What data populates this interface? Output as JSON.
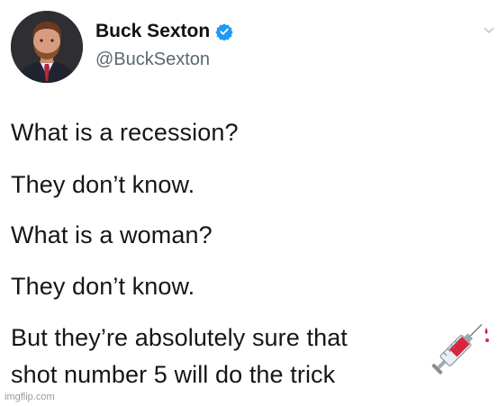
{
  "tweet": {
    "author": {
      "display_name": "Buck Sexton",
      "handle": "@BuckSexton",
      "verified": true,
      "avatar_icon": "profile-photo",
      "verified_icon": "verified-badge-icon",
      "verified_color": "#1d9bf0"
    },
    "lines": [
      "What is a recession?",
      "They don’t know.",
      "What is a woman?",
      "They don’t know.",
      "But they’re absolutely sure that",
      "shot number 5 will do the trick"
    ],
    "emoji": "syringe-icon"
  },
  "watermark": "imgflip.com",
  "colors": {
    "text": "#161616",
    "handle": "#5b6770",
    "background": "#ffffff"
  }
}
